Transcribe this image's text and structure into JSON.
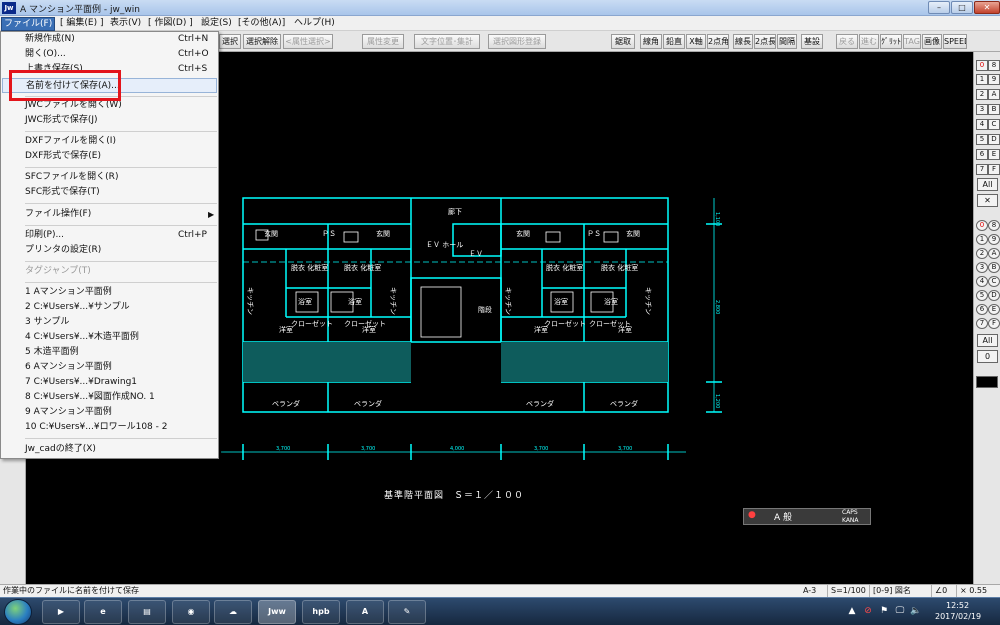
{
  "window": {
    "title": "A マンション平面例 - jw_win",
    "icon_label": "Jw",
    "minimize": "–",
    "maximize": "□",
    "close": "✕"
  },
  "menubar": [
    {
      "label": "ファイル(F)",
      "active": true
    },
    {
      "label": "[ 編集(E) ]",
      "active": false
    },
    {
      "label": "表示(V)",
      "active": false
    },
    {
      "label": "[ 作図(D) ]",
      "active": false
    },
    {
      "label": "設定(S)",
      "active": false
    },
    {
      "label": "[その他(A)]",
      "active": false
    },
    {
      "label": "ヘルプ(H)",
      "active": false
    }
  ],
  "toolbar": [
    {
      "label": "選択",
      "disabled": false
    },
    {
      "label": "選択解除",
      "disabled": false
    },
    {
      "label": "<属性選択>",
      "disabled": true
    },
    {
      "label": "属性変更",
      "disabled": true
    },
    {
      "label": "文字位置･集計",
      "disabled": true
    },
    {
      "label": "選択図形登録",
      "disabled": true
    },
    {
      "label": "鋸取",
      "disabled": false
    },
    {
      "label": "線角",
      "disabled": false
    },
    {
      "label": "鉛直",
      "disabled": false
    },
    {
      "label": "X軸",
      "disabled": false
    },
    {
      "label": "2点角",
      "disabled": false
    },
    {
      "label": "線長",
      "disabled": false
    },
    {
      "label": "2点長",
      "disabled": false
    },
    {
      "label": "間隔",
      "disabled": false
    },
    {
      "label": "基設",
      "disabled": false
    },
    {
      "label": "戻る",
      "disabled": true
    },
    {
      "label": "進む",
      "disabled": true
    },
    {
      "label": "ｸﾞﾘｯﾄﾞ",
      "disabled": false
    },
    {
      "label": "TAG",
      "disabled": true
    },
    {
      "label": "画像",
      "disabled": false
    },
    {
      "label": "SPEED",
      "disabled": false
    }
  ],
  "file_menu": {
    "items": [
      {
        "label": "新規作成(N)",
        "shortcut": "Ctrl+N"
      },
      {
        "label": "開く(O)...",
        "shortcut": "Ctrl+O"
      },
      {
        "label": "上書き保存(S)",
        "shortcut": "Ctrl+S"
      },
      {
        "label": "名前を付けて保存(A)...",
        "shortcut": ""
      },
      {
        "label": "JWCファイルを開く(W)",
        "shortcut": ""
      },
      {
        "label": "JWC形式で保存(J)",
        "shortcut": ""
      },
      {
        "label": "DXFファイルを開く(I)",
        "shortcut": ""
      },
      {
        "label": "DXF形式で保存(E)",
        "shortcut": ""
      },
      {
        "label": "SFCファイルを開く(R)",
        "shortcut": ""
      },
      {
        "label": "SFC形式で保存(T)",
        "shortcut": ""
      },
      {
        "label": "ファイル操作(F)",
        "shortcut": ""
      },
      {
        "label": "印刷(P)...",
        "shortcut": "Ctrl+P"
      },
      {
        "label": "プリンタの設定(R)",
        "shortcut": ""
      },
      {
        "label": "タグジャンプ(T)",
        "shortcut": ""
      },
      {
        "label": "1 Aマンション平面例",
        "shortcut": ""
      },
      {
        "label": "2 C:¥Users¥...¥サンプル",
        "shortcut": ""
      },
      {
        "label": "3 サンプル",
        "shortcut": ""
      },
      {
        "label": "4 C:¥Users¥...¥木造平面例",
        "shortcut": ""
      },
      {
        "label": "5 木造平面例",
        "shortcut": ""
      },
      {
        "label": "6 Aマンション平面例",
        "shortcut": ""
      },
      {
        "label": "7 C:¥Users¥...¥Drawing1",
        "shortcut": ""
      },
      {
        "label": "8 C:¥Users¥...¥図面作成NO. 1",
        "shortcut": ""
      },
      {
        "label": "9 Aマンション平面例",
        "shortcut": ""
      },
      {
        "label": "10 C:¥Users¥...¥ロワール108 - 2",
        "shortcut": ""
      },
      {
        "label": "Jw_cadの終了(X)",
        "shortcut": ""
      }
    ],
    "submenu_arrow": "▶"
  },
  "drawing": {
    "scale_label": "基準階平面図　Ｓ＝１／１００",
    "rooms": [
      "玄関",
      "玄関",
      "ＥＶ\nホール",
      "玄関",
      "玄関",
      "廊下",
      "ＰＳ",
      "ＰＳ",
      "ＥＶ",
      "脱衣\n化粧室",
      "脱衣\n化粧室",
      "脱衣\n化粧室",
      "脱衣\n化粧室",
      "浴室",
      "浴室",
      "浴室",
      "浴室",
      "キッチン",
      "キッチン",
      "キッチン",
      "キッチン",
      "クローゼット",
      "クローゼット",
      "クローゼット",
      "クローゼット",
      "洋室",
      "洋室",
      "洋室",
      "洋室",
      "ベランダ",
      "ベランダ",
      "ベランダ",
      "ベランダ",
      "階段"
    ],
    "dimensions": [
      "3,700",
      "3,700",
      "4,000",
      "3,700",
      "3,700"
    ],
    "side_dimensions": [
      "1,100",
      "2,800",
      "1,200"
    ],
    "colors": {
      "wall": "#00ffff",
      "fixture": "#ffffff",
      "background": "#000000",
      "dimension": "#00ffff"
    }
  },
  "ime_bar": {
    "label": "A 般",
    "caps": "CAPS",
    "kana": "KANA"
  },
  "right_panel": {
    "layers_a": [
      "0",
      "1",
      "2",
      "3",
      "4",
      "5",
      "6",
      "7"
    ],
    "layers_b": [
      "8",
      "9",
      "A",
      "B",
      "C",
      "D",
      "E",
      "F"
    ],
    "all_label": "All",
    "x_label": "✕",
    "groups": [
      "0",
      "1",
      "2",
      "3",
      "4",
      "5",
      "6",
      "7"
    ],
    "groups_b": [
      "8",
      "9",
      "A",
      "B",
      "C",
      "D",
      "E",
      "F"
    ],
    "all2_label": "All",
    "zero_label": "0"
  },
  "status": {
    "message": "作業中のファイルに名前を付けて保存",
    "paper": "A-3",
    "scale": "S=1/100",
    "layer": "[0-9] 図名",
    "angle": "∠0",
    "zoom": "× 0.55"
  },
  "taskbar": {
    "apps": [
      {
        "label": "▶",
        "name": "media"
      },
      {
        "label": "e",
        "name": "ie"
      },
      {
        "label": "▤",
        "name": "explorer"
      },
      {
        "label": "◉",
        "name": "chrome"
      },
      {
        "label": "☁",
        "name": "mail"
      },
      {
        "label": "Jww",
        "name": "jwcad"
      },
      {
        "label": "hpb",
        "name": "hpb"
      },
      {
        "label": "A",
        "name": "acrobat"
      },
      {
        "label": "✎",
        "name": "paint"
      }
    ],
    "tray": [
      "▲",
      "⊘",
      "⚑",
      "🖵",
      "🔈"
    ],
    "time": "12:52",
    "date": "2017/02/19"
  }
}
